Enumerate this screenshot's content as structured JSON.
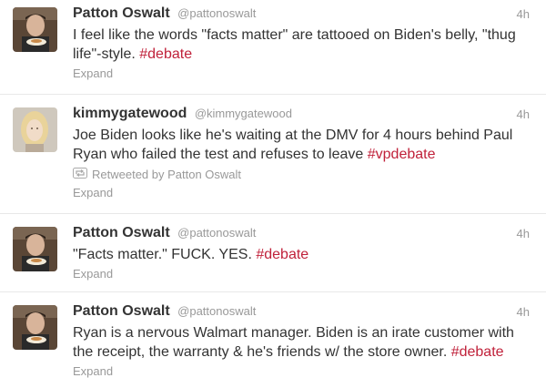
{
  "tweets": [
    {
      "fullname": "Patton Oswalt",
      "username": "@pattonoswalt",
      "time": "4h",
      "text": "I feel like the words \"facts matter\" are tattooed on Biden's belly, \"thug life\"-style. ",
      "hashtag": "#debate",
      "expand": "Expand"
    },
    {
      "fullname": "kimmygatewood",
      "username": "@kimmygatewood",
      "time": "4h",
      "text": "Joe Biden looks like he's waiting at the DMV for 4 hours behind Paul Ryan who failed the test and refuses to leave ",
      "hashtag": "#vpdebate",
      "retweeted": "Retweeted by Patton Oswalt",
      "expand": "Expand"
    },
    {
      "fullname": "Patton Oswalt",
      "username": "@pattonoswalt",
      "time": "4h",
      "text": "\"Facts matter.\" FUCK. YES. ",
      "hashtag": "#debate",
      "expand": "Expand"
    },
    {
      "fullname": "Patton Oswalt",
      "username": "@pattonoswalt",
      "time": "4h",
      "text": "Ryan is a nervous Walmart manager. Biden is an irate customer with the receipt, the warranty & he's friends w/ the store owner. ",
      "hashtag": "#debate",
      "expand": "Expand"
    }
  ],
  "icons": {
    "retweet": "retweet-icon"
  },
  "colors": {
    "hashtag": "#c0213a",
    "meta": "#999999",
    "text": "#333333"
  }
}
